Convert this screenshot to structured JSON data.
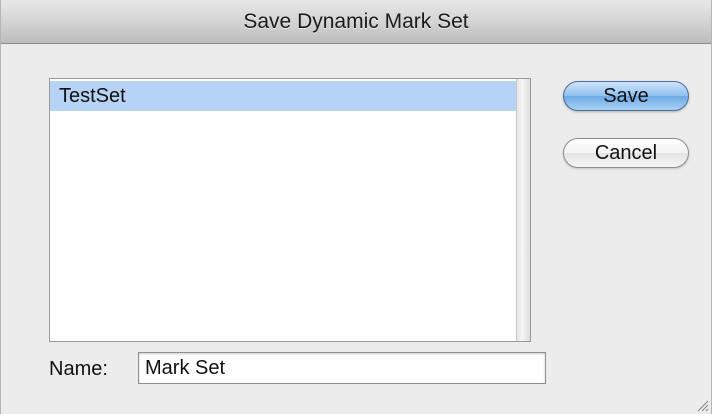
{
  "window": {
    "title": "Save Dynamic Mark Set"
  },
  "list": {
    "items": [
      {
        "label": "TestSet",
        "selected": true
      }
    ]
  },
  "buttons": {
    "save_label": "Save",
    "cancel_label": "Cancel"
  },
  "name_field": {
    "label": "Name:",
    "value": "Mark Set"
  },
  "colors": {
    "selection": "#b6d2f4",
    "default_button": "#8fc0f0",
    "window_background": "#ececec"
  }
}
